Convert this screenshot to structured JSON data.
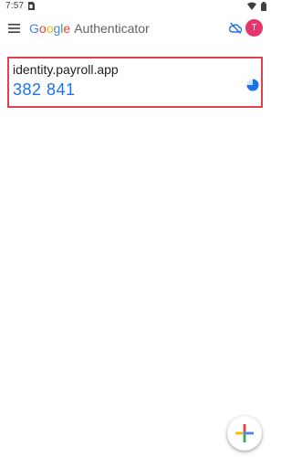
{
  "status_bar": {
    "time": "7:57"
  },
  "app_bar": {
    "brand_letters": [
      "G",
      "o",
      "o",
      "g",
      "l",
      "e"
    ],
    "app_name": "Authenticator",
    "avatar_initial": "T",
    "icons": [
      "menu-icon",
      "cloud-off-icon"
    ]
  },
  "accounts": [
    {
      "issuer": "identity.payroll.app",
      "code": "382 841",
      "timer_icon": "countdown-pie-icon"
    }
  ],
  "fab": {
    "icon": "add-icon"
  },
  "colors": {
    "code_blue": "#1a73e8",
    "highlight_border": "#e04050",
    "avatar_pink": "#e8336a",
    "google_blue": "#4285f4",
    "google_red": "#ea4335",
    "google_yellow": "#fbbc05",
    "google_green": "#34a853"
  }
}
